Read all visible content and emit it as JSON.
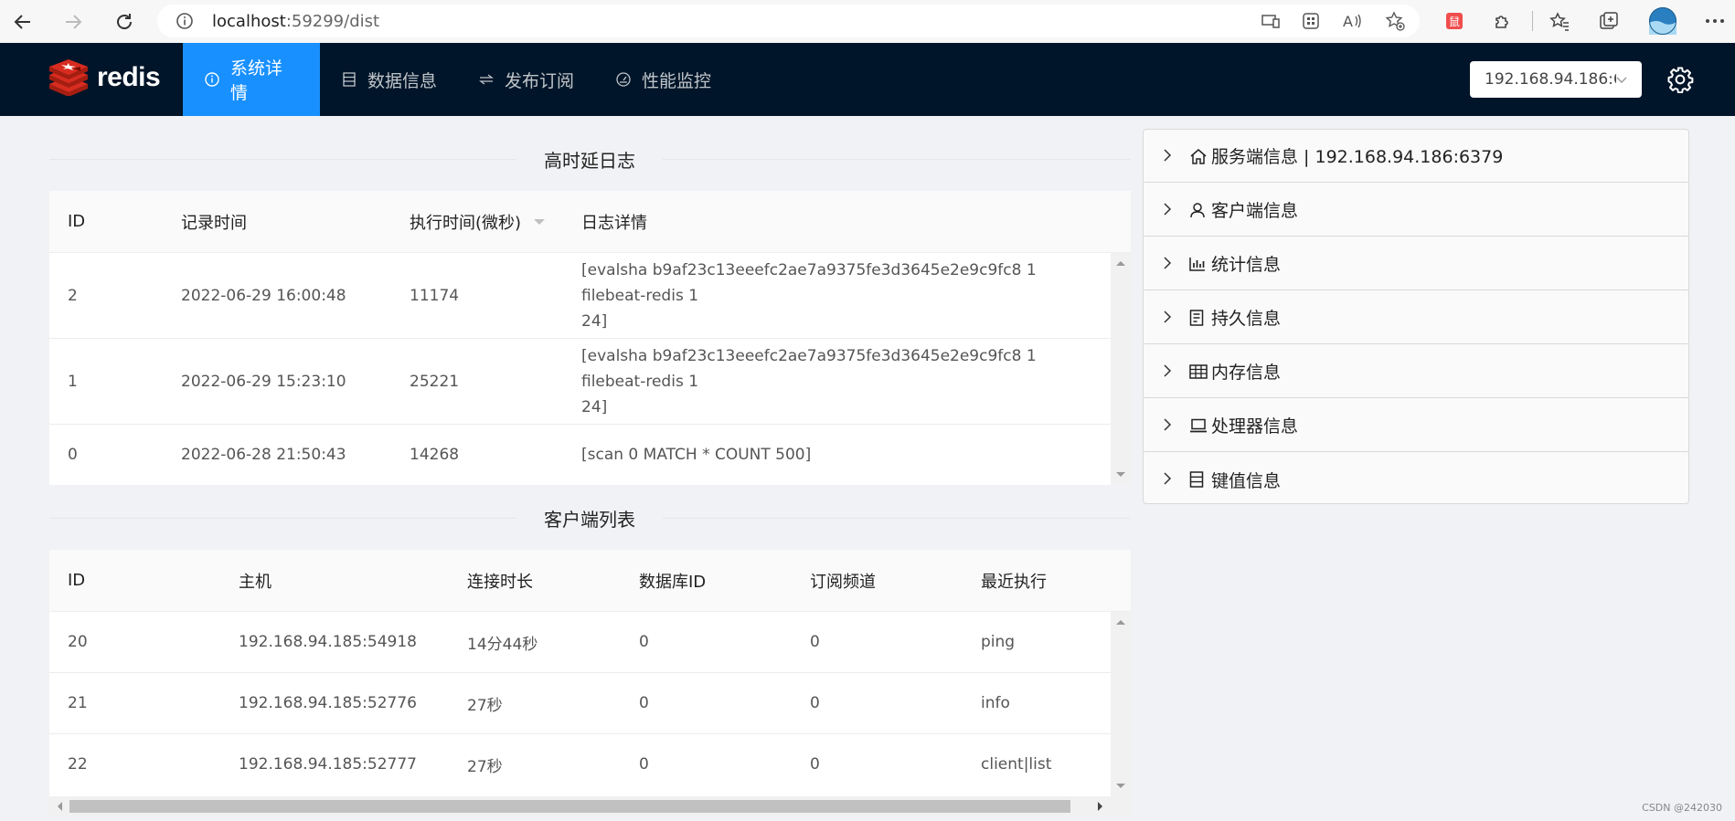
{
  "browser": {
    "url_host": "localhost",
    "url_rest": ":59299/dist"
  },
  "app": {
    "logo_text": "redis",
    "menu": [
      {
        "label": "系统详情",
        "icon": "info-circle-icon",
        "active": true
      },
      {
        "label": "数据信息",
        "icon": "database-icon",
        "active": false
      },
      {
        "label": "发布订阅",
        "icon": "swap-icon",
        "active": false
      },
      {
        "label": "性能监控",
        "icon": "dashboard-icon",
        "active": false
      }
    ],
    "server_select": "192.168.94.186:6..."
  },
  "slowlog": {
    "title": "高时延日志",
    "columns": [
      "ID",
      "记录时间",
      "执行时间(微秒)",
      "日志详情"
    ],
    "rows": [
      {
        "id": "2",
        "time": "2022-06-29 16:00:48",
        "exec": "11174",
        "detail_1": "[evalsha b9af23c13eeefc2ae7a9375fe3d3645e2e9c9fc8 1 filebeat-redis 1",
        "detail_2": "24]"
      },
      {
        "id": "1",
        "time": "2022-06-29 15:23:10",
        "exec": "25221",
        "detail_1": "[evalsha b9af23c13eeefc2ae7a9375fe3d3645e2e9c9fc8 1 filebeat-redis 1",
        "detail_2": "24]"
      },
      {
        "id": "0",
        "time": "2022-06-28 21:50:43",
        "exec": "14268",
        "detail_1": "[scan 0 MATCH * COUNT 500]",
        "detail_2": ""
      }
    ]
  },
  "clients": {
    "title": "客户端列表",
    "columns": [
      "ID",
      "主机",
      "连接时长",
      "数据库ID",
      "订阅频道",
      "最近执行"
    ],
    "rows": [
      {
        "id": "20",
        "host": "192.168.94.185:54918",
        "age": "14分44秒",
        "db": "0",
        "sub": "0",
        "cmd": "ping"
      },
      {
        "id": "21",
        "host": "192.168.94.185:52776",
        "age": "27秒",
        "db": "0",
        "sub": "0",
        "cmd": "info"
      },
      {
        "id": "22",
        "host": "192.168.94.185:52777",
        "age": "27秒",
        "db": "0",
        "sub": "0",
        "cmd": "client|list"
      }
    ]
  },
  "panels": [
    {
      "label": "服务端信息 | 192.168.94.186:6379",
      "icon": "home-icon"
    },
    {
      "label": "客户端信息",
      "icon": "user-icon"
    },
    {
      "label": "统计信息",
      "icon": "bar-chart-icon"
    },
    {
      "label": "持久信息",
      "icon": "file-icon"
    },
    {
      "label": "内存信息",
      "icon": "table-icon"
    },
    {
      "label": "处理器信息",
      "icon": "laptop-icon"
    },
    {
      "label": "键值信息",
      "icon": "database-icon"
    }
  ],
  "watermark": "CSDN @242030"
}
